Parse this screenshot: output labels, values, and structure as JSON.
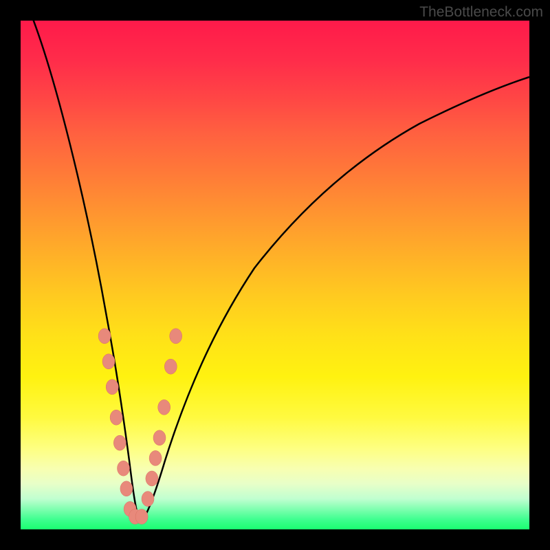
{
  "watermark": "TheBottleneck.com",
  "colors": {
    "curve_stroke": "#000000",
    "marker_fill": "#e8897b",
    "marker_stroke": "#d87060"
  },
  "chart_data": {
    "type": "line",
    "title": "",
    "xlabel": "",
    "ylabel": "",
    "xlim": [
      0,
      100
    ],
    "ylim": [
      0,
      100
    ],
    "note": "V-shaped bottleneck curve. Y-axis is inverted visually (0 at top). Low values (near x≈22) indicate no bottleneck (green zone at bottom). High values indicate severe bottleneck (red zone at top). Pink markers are sample data points clustered near the minimum.",
    "series": [
      {
        "name": "bottleneck-curve",
        "x": [
          2,
          5,
          8,
          11,
          14,
          16,
          18,
          19,
          20,
          21,
          22,
          23,
          24,
          25,
          26,
          27,
          28,
          30,
          35,
          40,
          50,
          60,
          70,
          80,
          90,
          100
        ],
        "y_from_top": [
          0,
          18,
          35,
          50,
          62,
          72,
          80,
          86,
          91,
          95,
          98,
          98,
          95,
          92,
          88,
          84,
          80,
          73,
          60,
          51,
          38,
          29,
          23,
          18,
          14,
          11
        ]
      }
    ],
    "markers": [
      {
        "x": 16.5,
        "y_from_top": 62
      },
      {
        "x": 17.3,
        "y_from_top": 67
      },
      {
        "x": 18.0,
        "y_from_top": 72
      },
      {
        "x": 18.8,
        "y_from_top": 78
      },
      {
        "x": 19.5,
        "y_from_top": 83
      },
      {
        "x": 20.2,
        "y_from_top": 88
      },
      {
        "x": 20.8,
        "y_from_top": 92
      },
      {
        "x": 21.5,
        "y_from_top": 96
      },
      {
        "x": 22.5,
        "y_from_top": 97.5
      },
      {
        "x": 23.8,
        "y_from_top": 97.5
      },
      {
        "x": 25.0,
        "y_from_top": 94
      },
      {
        "x": 25.8,
        "y_from_top": 90
      },
      {
        "x": 26.5,
        "y_from_top": 86
      },
      {
        "x": 27.3,
        "y_from_top": 82
      },
      {
        "x": 28.2,
        "y_from_top": 76
      },
      {
        "x": 29.5,
        "y_from_top": 68
      },
      {
        "x": 30.5,
        "y_from_top": 62
      }
    ]
  }
}
